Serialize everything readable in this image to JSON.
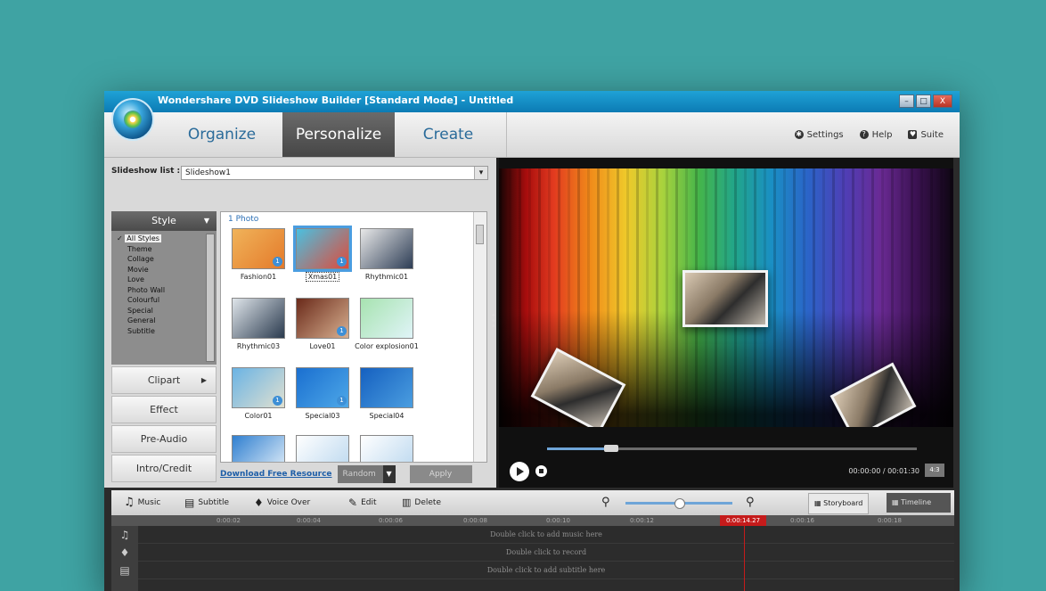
{
  "window": {
    "title": "Wondershare DVD Slideshow Builder [Standard Mode] - Untitled",
    "controls": {
      "minimize": "–",
      "maximize": "□",
      "close": "X"
    }
  },
  "nav": {
    "tabs": [
      {
        "label": "Organize"
      },
      {
        "label": "Personalize"
      },
      {
        "label": "Create"
      }
    ],
    "right": {
      "settings": "Settings",
      "help": "Help",
      "suite": "Suite"
    }
  },
  "slideshow": {
    "label": "Slideshow list :",
    "value": "Slideshow1"
  },
  "sidebar": {
    "style_header": "Style",
    "styles": [
      "All Styles",
      "Theme",
      "Collage",
      "Movie",
      "Love",
      "Photo Wall",
      "Colourful",
      "Special",
      "General",
      "Subtitle"
    ],
    "buttons": [
      "Clipart",
      "Effect",
      "Pre-Audio",
      "Intro/Credit"
    ]
  },
  "grid": {
    "count_label": "1 Photo",
    "items": [
      {
        "caption": "Fashion01",
        "colors": [
          "#f0b35a",
          "#e47a2a"
        ],
        "badge": "1"
      },
      {
        "caption": "Xmas01",
        "colors": [
          "#4ac0e0",
          "#e04a3a"
        ],
        "badge": "1",
        "selected": true
      },
      {
        "caption": "Rhythmic01",
        "colors": [
          "#e8e8e8",
          "#2d3d55"
        ],
        "badge": ""
      },
      {
        "caption": "Rhythmic03",
        "colors": [
          "#dfe5ea",
          "#2a3a4e"
        ],
        "badge": ""
      },
      {
        "caption": "Love01",
        "colors": [
          "#6a2a1a",
          "#d8b090"
        ],
        "badge": "1"
      },
      {
        "caption": "Color explosion01",
        "colors": [
          "#a7e3b0",
          "#e0f4f8"
        ],
        "badge": ""
      },
      {
        "caption": "Color01",
        "colors": [
          "#6ab3e4",
          "#e0e0d0"
        ],
        "badge": "1"
      },
      {
        "caption": "Special03",
        "colors": [
          "#1a6fd0",
          "#4ea8e8"
        ],
        "badge": "1"
      },
      {
        "caption": "Special04",
        "colors": [
          "#1560c0",
          "#4b9ee0"
        ],
        "badge": ""
      },
      {
        "caption": "",
        "colors": [
          "#2f7fd0",
          "#e8f2fa"
        ],
        "badge": ""
      },
      {
        "caption": "",
        "colors": [
          "#ffffff",
          "#b8d6ee"
        ],
        "badge": ""
      },
      {
        "caption": "",
        "colors": [
          "#ffffff",
          "#b8d6ee"
        ],
        "badge": ""
      }
    ]
  },
  "bottom_left": {
    "download": "Download Free Resource",
    "random": "Random",
    "apply": "Apply"
  },
  "player": {
    "time": "00:00:00 / 00:01:30",
    "ratio": "4:3",
    "progress": 0.18
  },
  "timeline_toolbar": {
    "music": "Music",
    "subtitle": "Subtitle",
    "voiceover": "Voice Over",
    "edit": "Edit",
    "delete": "Delete",
    "storyboard": "Storyboard",
    "timeline": "Timeline"
  },
  "ruler": {
    "ticks": [
      "0:00:02",
      "0:00:04",
      "0:00:06",
      "0:00:08",
      "0:00:10",
      "0:00:12",
      "0:00:16",
      "0:00:18"
    ],
    "current": "0:00:14.27"
  },
  "tracks": {
    "music_hint": "Double click to add music here",
    "record_hint": "Double click to record",
    "subtitle_hint": "Double click to add subtitle here"
  }
}
